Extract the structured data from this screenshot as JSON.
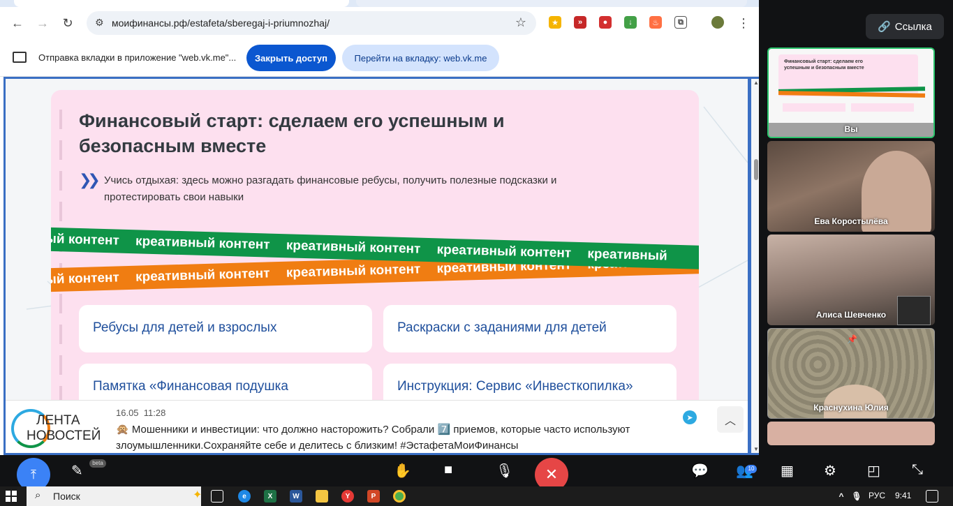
{
  "browser": {
    "url": "моифинансы.рф/estafeta/sberegaj-i-priumnozhaj/",
    "share_message": "Отправка вкладки в приложение \"web.vk.me\"...",
    "close_access_label": "Закрыть доступ",
    "goto_tab_label": "Перейти на вкладку: web.vk.me"
  },
  "page": {
    "title": "Финансовый старт: сделаем его успешным и безопасным вместе",
    "subtitle": "Учись отдыхая: здесь можно разгадать финансовые ребусы, получить полезные подсказки и протестировать свои навыки",
    "ribbon_text": "креативный контент",
    "ribbon_partial_left": "ный контент",
    "ribbon_partial_right": "креативный",
    "tiles": [
      "Ребусы для детей и взрослых",
      "Раскраски с заданиями для детей",
      "Памятка «Финансовая подушка",
      "Инструкция: Сервис «Инвесткопилка»"
    ]
  },
  "ticker": {
    "logo_line1": "ЛЕНТА",
    "logo_line2": "НОВОСТЕЙ",
    "date": "16.05",
    "time": "11:28",
    "text": "🙊 Мошенники и инвестиции: что должно насторожить? Собрали 7️⃣ приемов, которые часто используют злоумышленники.Сохраняйте себе и делитесь с близким! #ЭстафетаМоиФинансы"
  },
  "call": {
    "link_label": "Ссылка",
    "self_label": "Вы",
    "self_preview_title": "Финансовый старт: сделаем его успешным и безопасным вместе",
    "participants": [
      "Ева Коростылёва",
      "Алиса Шевченко",
      "Краснухина Юлия"
    ],
    "beta_label": "beta",
    "people_count": "10"
  },
  "taskbar": {
    "search_label": "Поиск",
    "lang": "РУС",
    "time": "9:41"
  }
}
